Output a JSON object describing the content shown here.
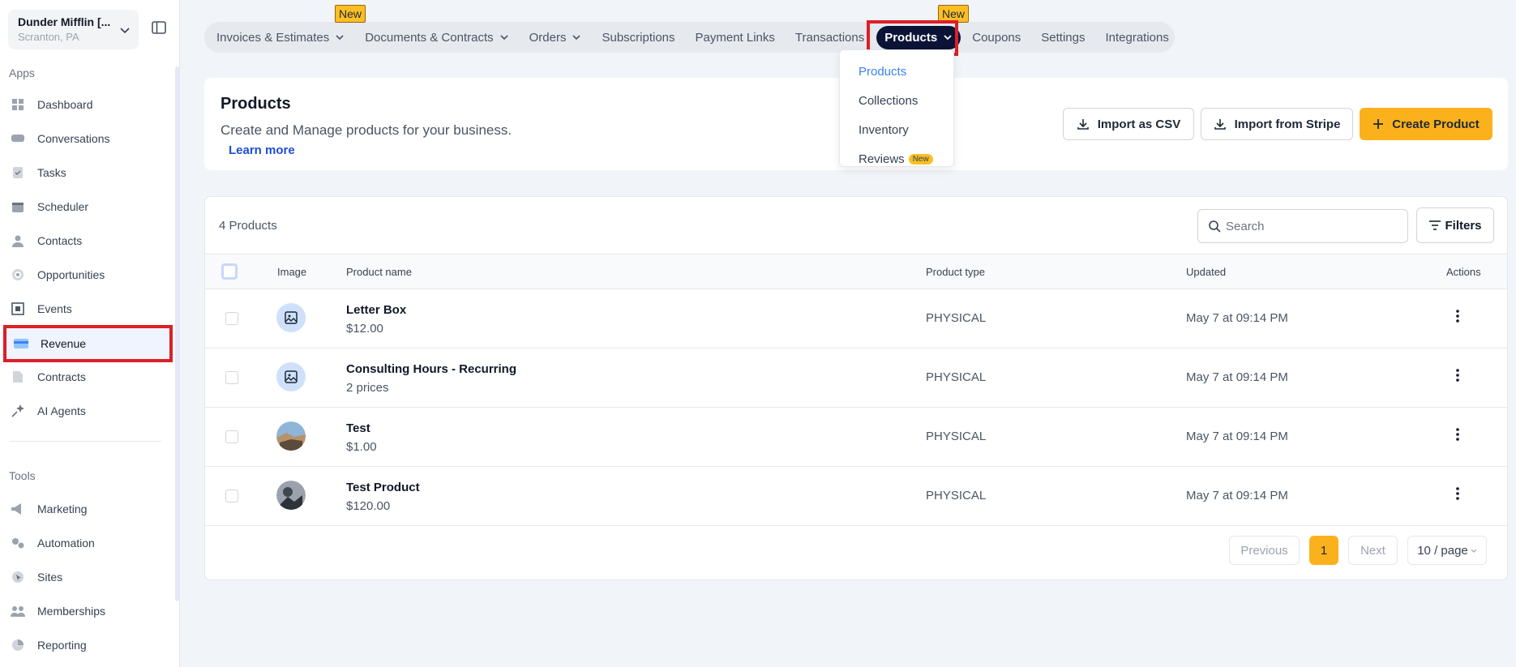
{
  "location": {
    "name": "Dunder Mifflin [...",
    "city": "Scranton, PA"
  },
  "sidebar": {
    "apps_label": "Apps",
    "tools_label": "Tools",
    "apps": [
      {
        "label": "Dashboard",
        "icon": "dashboard-icon"
      },
      {
        "label": "Conversations",
        "icon": "chat-icon"
      },
      {
        "label": "Tasks",
        "icon": "tasks-icon"
      },
      {
        "label": "Scheduler",
        "icon": "calendar-icon"
      },
      {
        "label": "Contacts",
        "icon": "person-icon"
      },
      {
        "label": "Opportunities",
        "icon": "target-icon"
      },
      {
        "label": "Events",
        "icon": "events-icon"
      },
      {
        "label": "Revenue",
        "icon": "credit-card-icon"
      },
      {
        "label": "Contracts",
        "icon": "document-icon"
      },
      {
        "label": "AI Agents",
        "icon": "sparkle-icon"
      }
    ],
    "tools": [
      {
        "label": "Marketing",
        "icon": "megaphone-icon"
      },
      {
        "label": "Automation",
        "icon": "gears-icon"
      },
      {
        "label": "Sites",
        "icon": "cursor-icon"
      },
      {
        "label": "Memberships",
        "icon": "people-icon"
      },
      {
        "label": "Reporting",
        "icon": "pie-icon"
      }
    ]
  },
  "topnav": {
    "new_badge": "New",
    "items": [
      "Invoices & Estimates",
      "Documents & Contracts",
      "Orders",
      "Subscriptions",
      "Payment Links",
      "Transactions",
      "Products",
      "Coupons",
      "Settings",
      "Integrations"
    ]
  },
  "dropdown": {
    "items": [
      "Products",
      "Collections",
      "Inventory",
      "Reviews"
    ],
    "new_badge": "New"
  },
  "header": {
    "title": "Products",
    "subtitle": "Create and Manage products for your business.",
    "learn_more": "Learn more",
    "import_csv": "Import as CSV",
    "import_stripe": "Import from Stripe",
    "create_product": "Create Product"
  },
  "table": {
    "count": "4 Products",
    "search_placeholder": "Search",
    "filters_label": "Filters",
    "columns": {
      "image": "Image",
      "name": "Product name",
      "type": "Product type",
      "updated": "Updated",
      "actions": "Actions"
    },
    "rows": [
      {
        "name": "Letter Box",
        "sub": "$12.00",
        "type": "PHYSICAL",
        "updated": "May 7 at 09:14 PM",
        "image": "placeholder"
      },
      {
        "name": "Consulting Hours - Recurring",
        "sub": "2 prices",
        "type": "PHYSICAL",
        "updated": "May 7 at 09:14 PM",
        "image": "placeholder"
      },
      {
        "name": "Test",
        "sub": "$1.00",
        "type": "PHYSICAL",
        "updated": "May 7 at 09:14 PM",
        "image": "photo"
      },
      {
        "name": "Test Product",
        "sub": "$120.00",
        "type": "PHYSICAL",
        "updated": "May 7 at 09:14 PM",
        "image": "photo"
      }
    ]
  },
  "pagination": {
    "previous": "Previous",
    "current": "1",
    "next": "Next",
    "page_size": "10 / page"
  },
  "colors": {
    "accent": "#fbb11b",
    "nav_selected": "#0b1437",
    "highlight": "#dc1f26",
    "link": "#1d4ed8"
  }
}
